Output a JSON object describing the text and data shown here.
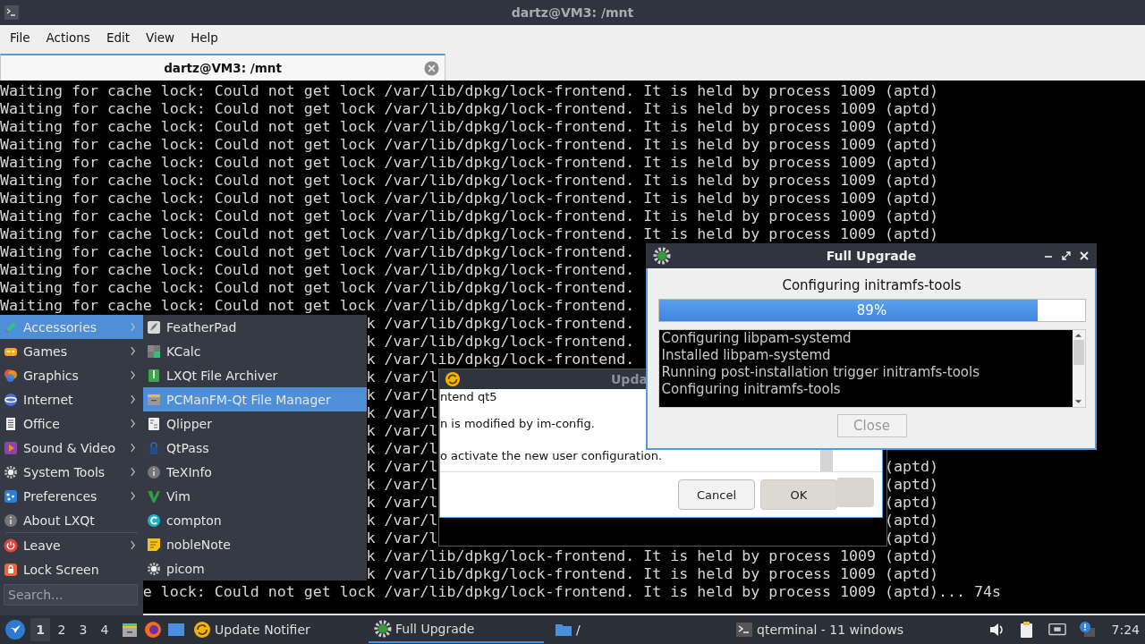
{
  "terminal_window": {
    "title": "dartz@VM3: /mnt",
    "menu": [
      "File",
      "Actions",
      "Edit",
      "View",
      "Help"
    ],
    "tabs": [
      {
        "label": "dartz@VM3: /mnt",
        "selected": true
      }
    ],
    "lines": [
      {
        "kind": "plain",
        "left": "Waiting for cache lock: Could not get lock /var/lib/dpkg/lock-frontend. It is held by process 1009 (aptd)"
      },
      {
        "kind": "plain",
        "left": "Waiting for cache lock: Could not get lock /var/lib/dpkg/lock-frontend. It is held by process 1009 (aptd)"
      },
      {
        "kind": "plain",
        "left": "Waiting for cache lock: Could not get lock /var/lib/dpkg/lock-frontend. It is held by process 1009 (aptd)"
      },
      {
        "kind": "plain",
        "left": "Waiting for cache lock: Could not get lock /var/lib/dpkg/lock-frontend. It is held by process 1009 (aptd)"
      },
      {
        "kind": "plain",
        "left": "Waiting for cache lock: Could not get lock /var/lib/dpkg/lock-frontend. It is held by process 1009 (aptd)"
      },
      {
        "kind": "plain",
        "left": "Waiting for cache lock: Could not get lock /var/lib/dpkg/lock-frontend. It is held by process 1009 (aptd)"
      },
      {
        "kind": "plain",
        "left": "Waiting for cache lock: Could not get lock /var/lib/dpkg/lock-frontend. It is held by process 1009 (aptd)"
      },
      {
        "kind": "plain",
        "left": "Waiting for cache lock: Could not get lock /var/lib/dpkg/lock-frontend. It is held by process 1009 (aptd)"
      },
      {
        "kind": "plain",
        "left": "Waiting for cache lock: Could not get lock /var/lib/dpkg/lock-frontend. It is held by process 1009 (aptd)"
      },
      {
        "kind": "plain",
        "left": "Waiting for cache lock: Could not get lock /var/lib/dpkg/lock-frontend."
      },
      {
        "kind": "plain",
        "left": "Waiting for cache lock: Could not get lock /var/lib/dpkg/lock-frontend."
      },
      {
        "kind": "plain",
        "left": "Waiting for cache lock: Could not get lock /var/lib/dpkg/lock-frontend."
      },
      {
        "kind": "plain",
        "left": "Waiting for cache lock: Could not get lock /var/lib/dpkg/lock-frontend."
      },
      {
        "kind": "behind_submenu",
        "left": "k /var/lib/dpkg/lock-frontend."
      },
      {
        "kind": "behind_submenu",
        "left": "k /var/lib/dpkg/lock-frontend."
      },
      {
        "kind": "behind_submenu",
        "left": "k /var/lib/dpkg/lock-frontend."
      },
      {
        "kind": "behind_submenu",
        "left": "k /var/l"
      },
      {
        "kind": "behind_submenu",
        "left": "k /var/l"
      },
      {
        "kind": "behind_submenu",
        "left": "k /var/l"
      },
      {
        "kind": "behind_submenu",
        "left": "k /var/l"
      },
      {
        "kind": "behind_submenu",
        "left": "k /var/l"
      },
      {
        "kind": "behind_submenu",
        "left": "k /var/l",
        "right": "(aptd)"
      },
      {
        "kind": "behind_submenu",
        "left": "k /var/l",
        "right": "(aptd)"
      },
      {
        "kind": "behind_submenu",
        "left": "k /var/l",
        "right": "(aptd)"
      },
      {
        "kind": "behind_submenu",
        "left": "k /var/l",
        "right": "(aptd)"
      },
      {
        "kind": "behind_submenu",
        "left": "k /var/l",
        "right": "(aptd)"
      },
      {
        "kind": "behind_submenu",
        "left": "k /var/lib/dpkg/lock-frontend. It is held by process 1009 (aptd)"
      },
      {
        "kind": "behind_submenu",
        "left": "k /var/lib/dpkg/lock-frontend. It is held by process 1009 (aptd)"
      },
      {
        "kind": "behind_menu",
        "left": "e lock: Could not get lock /var/lib/dpkg/lock-frontend. It is held by process 1009 (aptd)... 74s"
      }
    ]
  },
  "update_dialog": {
    "title": "Upda",
    "lines": [
      "ntend qt5",
      "n is modified by im-config.",
      "o activate the new user configuration."
    ],
    "buttons": [
      "Cancel",
      "OK"
    ]
  },
  "upgrade_window": {
    "title": "Full Upgrade",
    "status": "Configuring initramfs-tools",
    "progress": {
      "level": 0.89,
      "reading": "89%"
    },
    "log": [
      "Configuring libpam-systemd",
      "Installed libpam-systemd",
      "Running post-installation trigger initramfs-tools",
      "Configuring initramfs-tools"
    ],
    "close_button": {
      "label": "Close",
      "disabled": true
    }
  },
  "app_menu": {
    "categories": [
      {
        "label": "Accessories",
        "selected": true,
        "submenu": true
      },
      {
        "label": "Games",
        "selected": false,
        "submenu": true
      },
      {
        "label": "Graphics",
        "selected": false,
        "submenu": true
      },
      {
        "label": "Internet",
        "selected": false,
        "submenu": true
      },
      {
        "label": "Office",
        "selected": false,
        "submenu": true
      },
      {
        "label": "Sound & Video",
        "selected": false,
        "submenu": true
      },
      {
        "label": "System Tools",
        "selected": false,
        "submenu": true
      },
      {
        "label": "Preferences",
        "selected": false,
        "submenu": true
      },
      {
        "label": "About LXQt",
        "selected": false,
        "submenu": false
      },
      {
        "label": "Leave",
        "selected": false,
        "submenu": true
      },
      {
        "label": "Lock Screen",
        "selected": false,
        "submenu": false
      }
    ],
    "items": [
      {
        "label": "FeatherPad",
        "selected": false
      },
      {
        "label": "KCalc",
        "selected": false
      },
      {
        "label": "LXQt File Archiver",
        "selected": false
      },
      {
        "label": "PCManFM-Qt File Manager",
        "selected": true
      },
      {
        "label": "Qlipper",
        "selected": false
      },
      {
        "label": "QtPass",
        "selected": false
      },
      {
        "label": "TeXInfo",
        "selected": false
      },
      {
        "label": "Vim",
        "selected": false
      },
      {
        "label": "compton",
        "selected": false
      },
      {
        "label": "nobleNote",
        "selected": false
      },
      {
        "label": "picom",
        "selected": false
      }
    ],
    "search": {
      "placeholder": "Search..."
    }
  },
  "taskbar": {
    "desktops": [
      {
        "label": "1",
        "selected": true
      },
      {
        "label": "2",
        "selected": false
      },
      {
        "label": "3",
        "selected": false
      },
      {
        "label": "4",
        "selected": false
      }
    ],
    "tasks": [
      {
        "kind": "notifier",
        "label": "Update Notifier",
        "active": false
      },
      {
        "kind": "upgrade",
        "label": "Full Upgrade",
        "active": true
      },
      {
        "kind": "folder",
        "label": "/",
        "active": false
      },
      {
        "kind": "terminal",
        "label": "qterminal - 11 windows",
        "active": false
      }
    ],
    "clock": "7:24"
  }
}
